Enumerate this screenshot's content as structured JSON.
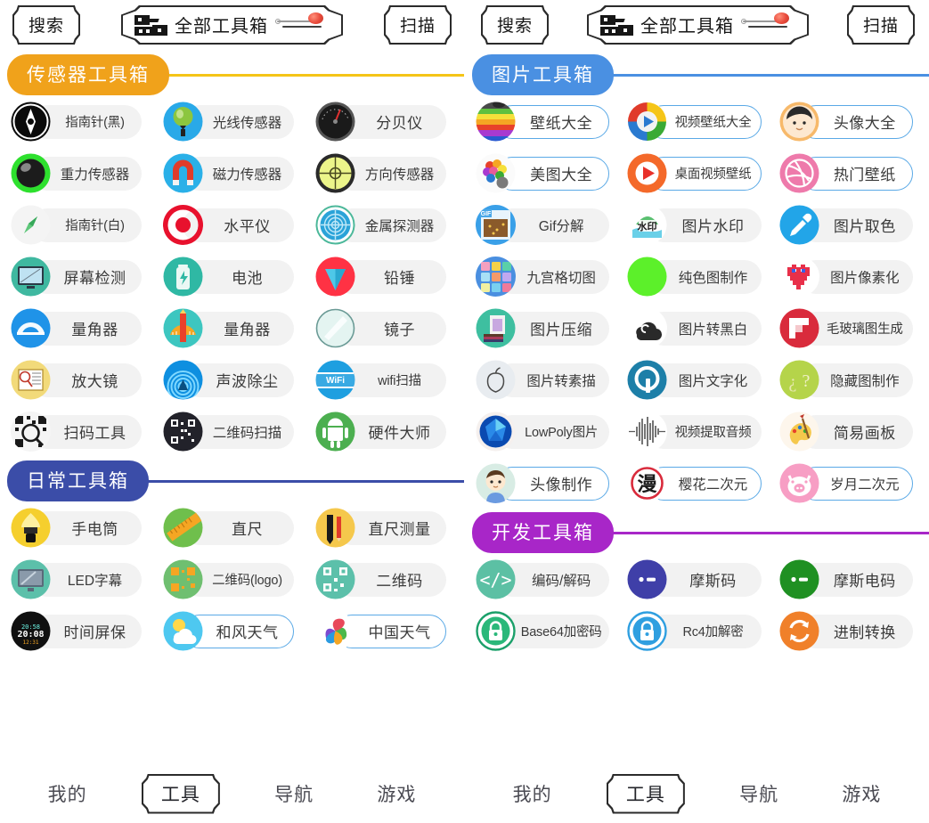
{
  "toolbar": {
    "search_label": "搜索",
    "center_label": "全部工具箱",
    "scan_label": "扫描",
    "toolbox_icon": "toolbox-icon",
    "pen_icon": "pen-line-icon",
    "badge_icon": "red-dot-badge"
  },
  "bottom_nav": {
    "items": [
      {
        "label": "我的",
        "selected": false
      },
      {
        "label": "工具",
        "selected": true
      },
      {
        "label": "导航",
        "selected": false
      },
      {
        "label": "游戏",
        "selected": false
      }
    ]
  },
  "left_panel": {
    "sections": [
      {
        "title": "传感器工具箱",
        "pill_color": "#F0A21B",
        "line_color": "#F5C518",
        "items": [
          {
            "label": "指南针(黑)",
            "icon": "compass-black-icon",
            "outlined": false,
            "colors": [
              "#1b1b1b",
              "#000000"
            ],
            "glyph": "compass_black"
          },
          {
            "label": "光线传感器",
            "icon": "light-sensor-icon",
            "outlined": false,
            "colors": [
              "#29a9e8",
              "#1a8fd0"
            ],
            "glyph": "light"
          },
          {
            "label": "分贝仪",
            "icon": "decibel-meter-icon",
            "outlined": false,
            "colors": [
              "#2a2a2a",
              "#111111"
            ],
            "glyph": "gauge"
          },
          {
            "label": "重力传感器",
            "icon": "gravity-sensor-icon",
            "outlined": false,
            "colors": [
              "#38e038",
              "#1fc01f"
            ],
            "glyph": "sphere"
          },
          {
            "label": "磁力传感器",
            "icon": "magnet-sensor-icon",
            "outlined": false,
            "colors": [
              "#2ab0e8",
              "#1a96d4"
            ],
            "glyph": "magnet"
          },
          {
            "label": "方向传感器",
            "icon": "direction-sensor-icon",
            "outlined": false,
            "colors": [
              "#e9f07a",
              "#d8e05a"
            ],
            "glyph": "bubble"
          },
          {
            "label": "指南针(白)",
            "icon": "compass-white-icon",
            "outlined": false,
            "colors": [
              "#f2f2f2",
              "#e6e6e6"
            ],
            "glyph": "compass_white"
          },
          {
            "label": "水平仪",
            "icon": "level-icon",
            "outlined": false,
            "colors": [
              "#ffffff",
              "#ffffff"
            ],
            "glyph": "target_red"
          },
          {
            "label": "金属探测器",
            "icon": "metal-detector-icon",
            "outlined": false,
            "colors": [
              "#39b89a",
              "#2f9f87"
            ],
            "glyph": "radar"
          },
          {
            "label": "屏幕检测",
            "icon": "screen-test-icon",
            "outlined": false,
            "colors": [
              "#3fb8a0",
              "#2fa58d"
            ],
            "glyph": "monitor"
          },
          {
            "label": "电池",
            "icon": "battery-icon",
            "outlined": false,
            "colors": [
              "#2fb8a4",
              "#25a291"
            ],
            "glyph": "battery"
          },
          {
            "label": "铅锤",
            "icon": "plumb-bob-icon",
            "outlined": false,
            "colors": [
              "#ff3b47",
              "#e0202f"
            ],
            "glyph": "plumb"
          },
          {
            "label": "量角器",
            "icon": "protractor-blue-icon",
            "outlined": false,
            "colors": [
              "#1f93e8",
              "#0f7ed0"
            ],
            "glyph": "protractor_b"
          },
          {
            "label": "量角器",
            "icon": "protractor-orange-icon",
            "outlined": false,
            "colors": [
              "#3dc6c0",
              "#31b0ab"
            ],
            "glyph": "protractor_o"
          },
          {
            "label": "镜子",
            "icon": "mirror-icon",
            "outlined": false,
            "colors": [
              "#dff3f0",
              "#cfeae6"
            ],
            "glyph": "mirror"
          },
          {
            "label": "放大镜",
            "icon": "magnifier-icon",
            "outlined": false,
            "colors": [
              "#f2da7a",
              "#e8cb5f"
            ],
            "glyph": "magnify"
          },
          {
            "label": "声波除尘",
            "icon": "sound-dust-icon",
            "outlined": false,
            "colors": [
              "#1ea6f0",
              "#0f84d0"
            ],
            "glyph": "waves"
          },
          {
            "label": "wifi扫描",
            "icon": "wifi-scan-icon",
            "outlined": false,
            "colors": [
              "#1e9fe0",
              "#0f86c8"
            ],
            "glyph": "wifi"
          },
          {
            "label": "扫码工具",
            "icon": "qr-scan-tool-icon",
            "outlined": false,
            "colors": [
              "#f5f5f5",
              "#eeeeee"
            ],
            "glyph": "qr_light"
          },
          {
            "label": "二维码扫描",
            "icon": "qr-scan-icon",
            "outlined": false,
            "colors": [
              "#2b2b33",
              "#16161c"
            ],
            "glyph": "qr_dark"
          },
          {
            "label": "硬件大师",
            "icon": "hardware-master-icon",
            "outlined": false,
            "colors": [
              "#4caf50",
              "#3c9740"
            ],
            "glyph": "android"
          }
        ]
      },
      {
        "title": "日常工具箱",
        "pill_color": "#3B4DA8",
        "line_color": "#3B4DA8",
        "items": [
          {
            "label": "手电筒",
            "icon": "flashlight-icon",
            "outlined": false,
            "colors": [
              "#f5cf2e",
              "#e8b91c"
            ],
            "glyph": "flashlight"
          },
          {
            "label": "直尺",
            "icon": "ruler-icon",
            "outlined": false,
            "colors": [
              "#6fbf4c",
              "#5aa93c"
            ],
            "glyph": "ruler"
          },
          {
            "label": "直尺测量",
            "icon": "ruler-measure-icon",
            "outlined": false,
            "colors": [
              "#f5c84c",
              "#e6b63a"
            ],
            "glyph": "pencils"
          },
          {
            "label": "LED字幕",
            "icon": "led-subtitle-icon",
            "outlined": false,
            "colors": [
              "#5cc0aa",
              "#4aab96"
            ],
            "glyph": "monitor2"
          },
          {
            "label": "二维码(logo)",
            "icon": "qr-logo-icon",
            "outlined": false,
            "colors": [
              "#6fbf70",
              "#5aa95c"
            ],
            "glyph": "qr_orange"
          },
          {
            "label": "二维码",
            "icon": "qr-code-icon",
            "outlined": false,
            "colors": [
              "#5cc0aa",
              "#4aab96"
            ],
            "glyph": "qr_white"
          },
          {
            "label": "时间屏保",
            "icon": "time-screensaver-icon",
            "outlined": false,
            "colors": [
              "#181818",
              "#000000"
            ],
            "glyph": "clock"
          },
          {
            "label": "和风天气",
            "icon": "hefeng-weather-icon",
            "outlined": true,
            "colors": [
              "#4ec8f0",
              "#2fb2e0"
            ],
            "glyph": "weather"
          },
          {
            "label": "中国天气",
            "icon": "china-weather-icon",
            "outlined": true,
            "colors": [
              "#ffffff",
              "#ffffff"
            ],
            "glyph": "swirl"
          }
        ]
      }
    ]
  },
  "right_panel": {
    "sections": [
      {
        "title": "图片工具箱",
        "pill_color": "#4A90E2",
        "line_color": "#4A90E2",
        "items": [
          {
            "label": "壁纸大全",
            "icon": "wallpaper-gallery-icon",
            "outlined": true,
            "colors": [
              "#6a4a2a",
              "#3a2a1a"
            ],
            "glyph": "rainbow_apple"
          },
          {
            "label": "视频壁纸大全",
            "icon": "video-wallpaper-icon",
            "outlined": true,
            "colors": [
              "#ffffff",
              "#f0f0f0"
            ],
            "glyph": "play_ring"
          },
          {
            "label": "头像大全",
            "icon": "avatar-gallery-icon",
            "outlined": true,
            "colors": [
              "#fff4e8",
              "#ffe8d0"
            ],
            "glyph": "avatar_boy"
          },
          {
            "label": "美图大全",
            "icon": "meitu-gallery-icon",
            "outlined": true,
            "colors": [
              "#fbfbfb",
              "#f2f2f2"
            ],
            "glyph": "flowers"
          },
          {
            "label": "桌面视频壁纸",
            "icon": "desktop-video-wallpaper-icon",
            "outlined": true,
            "colors": [
              "#f4692a",
              "#e0561c"
            ],
            "glyph": "play_orange"
          },
          {
            "label": "热门壁纸",
            "icon": "hot-wallpaper-icon",
            "outlined": true,
            "colors": [
              "#ee7aab",
              "#e05d96"
            ],
            "glyph": "dribbble"
          },
          {
            "label": "Gif分解",
            "icon": "gif-split-icon",
            "outlined": false,
            "colors": [
              "#3aa0e8",
              "#2f86c8"
            ],
            "glyph": "gif"
          },
          {
            "label": "图片水印",
            "icon": "image-watermark-icon",
            "outlined": false,
            "colors": [
              "#ffffff",
              "#f5f5f5"
            ],
            "glyph": "watermark"
          },
          {
            "label": "图片取色",
            "icon": "image-color-picker-icon",
            "outlined": false,
            "colors": [
              "#22a5e8",
              "#128ad0"
            ],
            "glyph": "eyedropper"
          },
          {
            "label": "九宫格切图",
            "icon": "grid-crop-icon",
            "outlined": false,
            "colors": [
              "#4a8fe0",
              "#3a78c8"
            ],
            "glyph": "grid9"
          },
          {
            "label": "纯色图制作",
            "icon": "solid-color-image-icon",
            "outlined": false,
            "colors": [
              "#5cf02a",
              "#42dd14"
            ],
            "glyph": "solid"
          },
          {
            "label": "图片像素化",
            "icon": "image-pixelate-icon",
            "outlined": false,
            "colors": [
              "#ffffff",
              "#ffffff"
            ],
            "glyph": "pixel_heart"
          },
          {
            "label": "图片压缩",
            "icon": "image-compress-icon",
            "outlined": false,
            "colors": [
              "#3ebfa0",
              "#2fa88a"
            ],
            "glyph": "compress"
          },
          {
            "label": "图片转黑白",
            "icon": "image-to-grayscale-icon",
            "outlined": false,
            "colors": [
              "#ffffff",
              "#ffffff"
            ],
            "glyph": "cloud_dark"
          },
          {
            "label": "毛玻璃图生成",
            "icon": "frosted-glass-icon",
            "outlined": false,
            "colors": [
              "#d92b3c",
              "#c01e2f"
            ],
            "glyph": "flipboard"
          },
          {
            "label": "图片转素描",
            "icon": "image-to-sketch-icon",
            "outlined": false,
            "colors": [
              "#e8ecf0",
              "#dde2e8"
            ],
            "glyph": "apple_line"
          },
          {
            "label": "图片文字化",
            "icon": "image-to-text-icon",
            "outlined": false,
            "colors": [
              "#1d7fa8",
              "#166a8e"
            ],
            "glyph": "q_letter"
          },
          {
            "label": "隐藏图制作",
            "icon": "hidden-image-icon",
            "outlined": false,
            "colors": [
              "#b5d44a",
              "#9dc033"
            ],
            "glyph": "question"
          },
          {
            "label": "LowPoly图片",
            "icon": "lowpoly-image-icon",
            "outlined": false,
            "colors": [
              "#f5f0ee",
              "#ece6e3"
            ],
            "glyph": "gem"
          },
          {
            "label": "视频提取音频",
            "icon": "video-extract-audio-icon",
            "outlined": false,
            "colors": [
              "#ffffff",
              "#ffffff"
            ],
            "glyph": "waveform"
          },
          {
            "label": "简易画板",
            "icon": "simple-drawing-board-icon",
            "outlined": false,
            "colors": [
              "#fdf6ec",
              "#f7ecdc"
            ],
            "glyph": "palette"
          },
          {
            "label": "头像制作",
            "icon": "avatar-maker-icon",
            "outlined": true,
            "colors": [
              "#d8ece4",
              "#c8e2d8"
            ],
            "glyph": "avatar_kid"
          },
          {
            "label": "樱花二次元",
            "icon": "sakura-anime-icon",
            "outlined": true,
            "colors": [
              "#ffffff",
              "#ffffff"
            ],
            "glyph": "manga"
          },
          {
            "label": "岁月二次元",
            "icon": "suiyue-anime-icon",
            "outlined": true,
            "colors": [
              "#f79ec4",
              "#ef82b2"
            ],
            "glyph": "pig"
          }
        ]
      },
      {
        "title": "开发工具箱",
        "pill_color": "#A826C8",
        "line_color": "#A826C8",
        "items": [
          {
            "label": "编码/解码",
            "icon": "encode-decode-icon",
            "outlined": false,
            "colors": [
              "#5cc0a4",
              "#49ab90"
            ],
            "glyph": "code"
          },
          {
            "label": "摩斯码",
            "icon": "morse-code-icon",
            "outlined": false,
            "colors": [
              "#3f3fa8",
              "#33338e"
            ],
            "glyph": "morse"
          },
          {
            "label": "摩斯电码",
            "icon": "morse-telegraph-icon",
            "outlined": false,
            "colors": [
              "#1f9022",
              "#18771b"
            ],
            "glyph": "morse"
          },
          {
            "label": "Base64加密码",
            "icon": "base64-encrypt-icon",
            "outlined": false,
            "colors": [
              "#ffffff",
              "#ffffff"
            ],
            "glyph": "lock_green"
          },
          {
            "label": "Rc4加解密",
            "icon": "rc4-crypt-icon",
            "outlined": false,
            "colors": [
              "#2f9fe0",
              "#1f86c8"
            ],
            "glyph": "lock_blue"
          },
          {
            "label": "进制转换",
            "icon": "radix-convert-icon",
            "outlined": false,
            "colors": [
              "#f0802a",
              "#dd6c18"
            ],
            "glyph": "convert"
          }
        ]
      }
    ]
  }
}
